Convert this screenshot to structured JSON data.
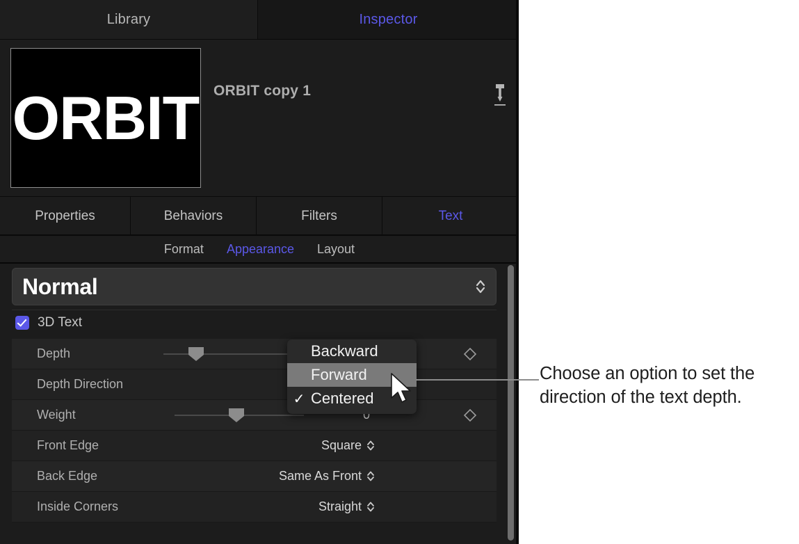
{
  "window_tabs": [
    {
      "label": "Library",
      "active": false
    },
    {
      "label": "Inspector",
      "active": true
    }
  ],
  "header": {
    "object_title": "ORBIT copy 1",
    "thumbnail_text": "ORBIT",
    "pin_icon": "pin-icon"
  },
  "category_tabs": [
    {
      "label": "Properties",
      "active": false
    },
    {
      "label": "Behaviors",
      "active": false
    },
    {
      "label": "Filters",
      "active": false
    },
    {
      "label": "Text",
      "active": true
    }
  ],
  "sub_tabs": [
    {
      "label": "Format",
      "active": false
    },
    {
      "label": "Appearance",
      "active": true
    },
    {
      "label": "Layout",
      "active": false
    }
  ],
  "style_popup": {
    "value": "Normal",
    "stepper_icon": "stepper-chevrons-icon"
  },
  "three_d_text": {
    "label": "3D Text",
    "checked": true,
    "checkbox_color": "#5b58e8"
  },
  "parameters": [
    {
      "label": "Depth",
      "value": "",
      "has_slider": true,
      "has_keyframe": true,
      "has_stepper": false
    },
    {
      "label": "Depth Direction",
      "value": "",
      "has_slider": false,
      "has_keyframe": false,
      "has_stepper": false
    },
    {
      "label": "Weight",
      "value": "0",
      "has_slider": true,
      "has_keyframe": true,
      "has_stepper": false
    },
    {
      "label": "Front Edge",
      "value": "Square",
      "has_slider": false,
      "has_keyframe": false,
      "has_stepper": true
    },
    {
      "label": "Back Edge",
      "value": "Same As Front",
      "has_slider": false,
      "has_keyframe": false,
      "has_stepper": true
    },
    {
      "label": "Inside Corners",
      "value": "Straight",
      "has_slider": false,
      "has_keyframe": false,
      "has_stepper": true
    }
  ],
  "open_menu": {
    "items": [
      {
        "label": "Backward",
        "selected": false,
        "highlighted": false,
        "check": ""
      },
      {
        "label": "Forward",
        "selected": false,
        "highlighted": true,
        "check": ""
      },
      {
        "label": "Centered",
        "selected": true,
        "highlighted": false,
        "check": "✓"
      }
    ]
  },
  "callout": {
    "text": "Choose an option to set the direction of the text depth."
  },
  "colors": {
    "accent": "#5b58e8",
    "panel_bg": "#1c1c1c",
    "row_bg": "#252525",
    "menu_bg": "#2a2a2a",
    "menu_highlight": "#7a7a7a",
    "callout_text": "#1d1d1d"
  }
}
